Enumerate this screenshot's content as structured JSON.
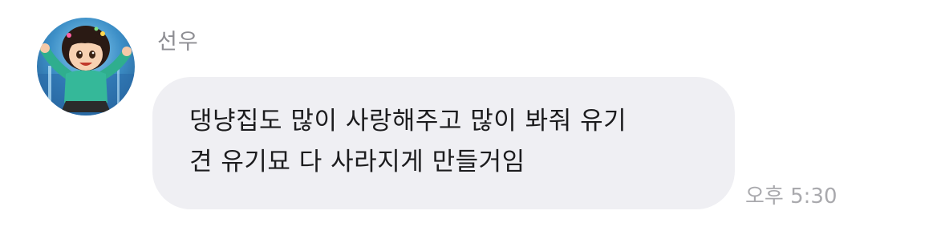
{
  "message": {
    "sender": "선우",
    "avatar_icon": "cartoon-girl-avatar-icon",
    "text_lines": [
      "댕냥집도 많이 사랑해주고 많이 봐줘 유기",
      "견 유기묘 다 사라지게 만들거임"
    ],
    "time": "오후 5:30"
  },
  "colors": {
    "bubble": "#efeff3",
    "name": "#8e8e93",
    "time": "#a9a9ad",
    "text": "#1c1c1e"
  }
}
